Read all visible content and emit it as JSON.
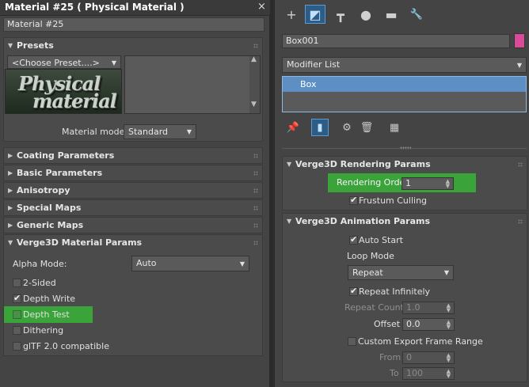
{
  "left_panel": {
    "title": "Material #25  ( Physical Material )",
    "close_glyph": "×",
    "material_name": "Material #25",
    "presets": {
      "header": "Presets",
      "choose_preset": "<Choose Preset....>",
      "thumb_line1": "Physical",
      "thumb_line2": "material",
      "material_mode_label": "Material mode:",
      "material_mode_value": "Standard"
    },
    "collapsed_rollouts": [
      "Coating Parameters",
      "Basic Parameters",
      "Anisotropy",
      "Special Maps",
      "Generic Maps"
    ],
    "verge3d": {
      "header": "Verge3D Material Params",
      "alpha_mode_label": "Alpha Mode:",
      "alpha_mode_value": "Auto",
      "options": [
        {
          "label": "2-Sided",
          "checked": false,
          "highlight": false
        },
        {
          "label": "Depth Write",
          "checked": true,
          "highlight": false
        },
        {
          "label": "Depth Test",
          "checked": false,
          "highlight": true
        },
        {
          "label": "Dithering",
          "checked": false,
          "highlight": false
        },
        {
          "label": "glTF 2.0 compatible",
          "checked": false,
          "highlight": false
        }
      ]
    }
  },
  "right_panel": {
    "tabs": [
      {
        "icon": "create-icon",
        "glyph": "+"
      },
      {
        "icon": "modify-icon",
        "glyph": "◩"
      },
      {
        "icon": "hierarchy-icon",
        "glyph": "┳"
      },
      {
        "icon": "motion-icon",
        "glyph": "●"
      },
      {
        "icon": "display-icon",
        "glyph": "▬"
      },
      {
        "icon": "utilities-icon",
        "glyph": "🔧"
      }
    ],
    "object_name": "Box001",
    "object_color": "#d84c97",
    "modifier_list": "Modifier List",
    "stack_item": "Box",
    "rendering": {
      "header": "Verge3D Rendering Params",
      "render_order_label": "Rendering Order",
      "render_order_value": "1",
      "frustum_culling": "Frustum Culling"
    },
    "animation": {
      "header": "Verge3D Animation Params",
      "auto_start": "Auto Start",
      "loop_mode_label": "Loop Mode",
      "loop_mode_value": "Repeat",
      "repeat_infinitely": "Repeat Infinitely",
      "repeat_count_label": "Repeat Count",
      "repeat_count_value": "1.0",
      "offset_label": "Offset",
      "offset_value": "0.0",
      "custom_range": "Custom Export Frame Range",
      "from_label": "From",
      "from_value": "0",
      "to_label": "To",
      "to_value": "100"
    }
  },
  "colors": {
    "highlight_green": "#3aa33a",
    "selection_blue": "#5d8fc5",
    "active_tab": "#2d5c86"
  }
}
